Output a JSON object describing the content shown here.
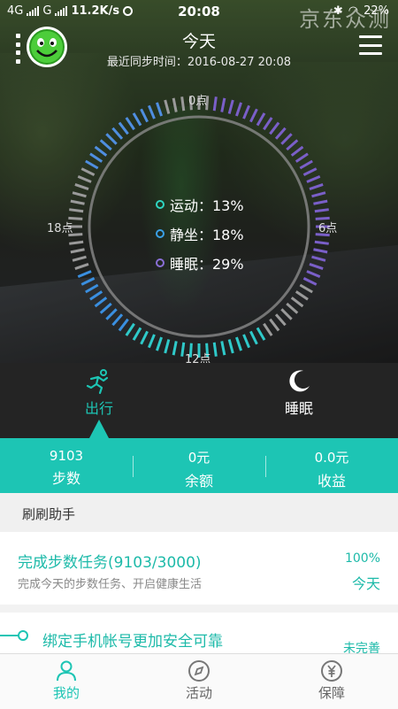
{
  "status_bar": {
    "network": "4G",
    "carrier_signal": "G",
    "speed": "11.2K/s",
    "time": "20:08",
    "battery": "22%",
    "watermark": "京东众测"
  },
  "header": {
    "title": "今天",
    "last_sync_label": "最近同步时间：2016-08-27 20:08"
  },
  "dial": {
    "hour_labels": {
      "top": "0点",
      "right": "6点",
      "bottom": "12点",
      "left": "18点"
    }
  },
  "activity_legend": [
    {
      "label": "运动：13%",
      "color": "#2fd6c2"
    },
    {
      "label": "静坐：18%",
      "color": "#3aa0e8"
    },
    {
      "label": "睡眠：29%",
      "color": "#8a6fd6"
    }
  ],
  "mode_tabs": [
    {
      "label": "出行",
      "active": true,
      "icon": "running-person-icon"
    },
    {
      "label": "睡眠",
      "active": false,
      "icon": "moon-icon"
    }
  ],
  "stats": [
    {
      "value": "9103",
      "label": "步数"
    },
    {
      "value": "0元",
      "label": "余额"
    },
    {
      "value": "0.0元",
      "label": "收益"
    }
  ],
  "assistant": {
    "section_title": "刷刷助手",
    "task": {
      "title": "完成步数任务(9103/3000)",
      "description": "完成今天的步数任务、开启健康生活",
      "progress": "100%",
      "day_label": "今天"
    },
    "bind_task": {
      "title": "绑定手机帐号更加安全可靠",
      "right_label": "未完善"
    }
  },
  "bottom_nav": [
    {
      "label": "我的",
      "active": true,
      "icon": "person-icon"
    },
    {
      "label": "活动",
      "active": false,
      "icon": "compass-icon"
    },
    {
      "label": "保障",
      "active": false,
      "icon": "yuan-shield-icon"
    }
  ],
  "colors": {
    "accent": "#1dc5b4",
    "accent_text": "#1dbaa9"
  }
}
